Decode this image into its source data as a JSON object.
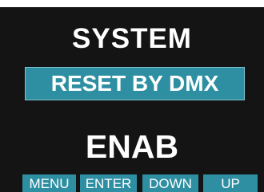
{
  "display": {
    "title": "SYSTEM",
    "selected_item": "RESET BY DMX",
    "value": "ENAB"
  },
  "softkeys": {
    "menu": "MENU",
    "enter": "ENTER",
    "down": "DOWN",
    "up": "UP"
  },
  "colors": {
    "background": "#141414",
    "accent": "#2e8fa3",
    "text": "#ffffff"
  }
}
